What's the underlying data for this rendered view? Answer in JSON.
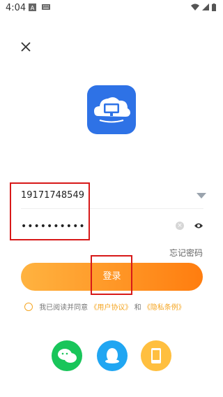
{
  "status_bar": {
    "time": "4:04"
  },
  "form": {
    "phone_value": "19171748549",
    "password_mask": "••••••••••",
    "forgot_label": "忘记密码"
  },
  "login": {
    "label": "登录"
  },
  "agreement": {
    "prefix": "我已阅读并同意",
    "user_agreement": "《用户协议》",
    "and": "和",
    "privacy": "《隐私条例》"
  },
  "social": {
    "items": [
      "wechat-icon",
      "qq-icon",
      "phone-icon"
    ]
  },
  "colors": {
    "accent": "#ff9a2a",
    "brand_blue": "#2e72e6"
  }
}
